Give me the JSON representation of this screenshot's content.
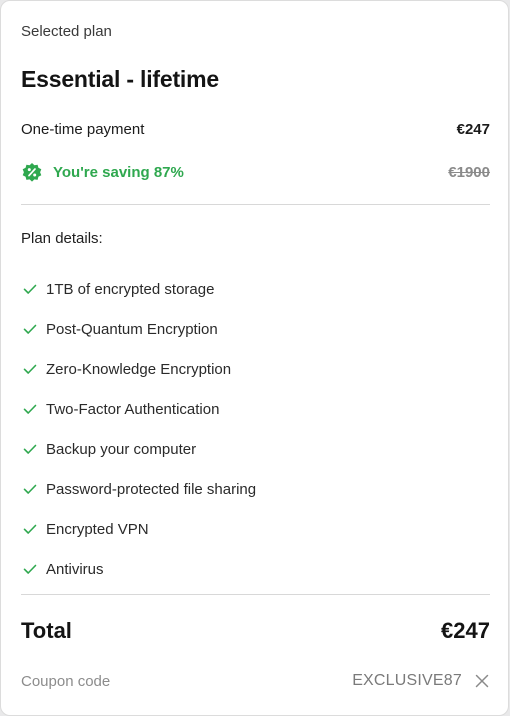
{
  "summary": {
    "selected_label": "Selected plan",
    "plan_name": "Essential - lifetime",
    "payment_label": "One-time payment",
    "payment_value": "€247",
    "saving_text": "You're saving 87%",
    "original_price": "€1900",
    "details_label": "Plan details:",
    "features": [
      "1TB of encrypted storage",
      "Post-Quantum Encryption",
      "Zero-Knowledge Encryption",
      "Two-Factor Authentication",
      "Backup your computer",
      "Password-protected file sharing",
      "Encrypted VPN",
      "Antivirus"
    ],
    "total_label": "Total",
    "total_value": "€247",
    "coupon_label": "Coupon code",
    "coupon_value": "EXCLUSIVE87"
  },
  "icons": {
    "discount": "percent-badge-icon",
    "check": "check-icon",
    "remove": "close-icon"
  },
  "colors": {
    "accent_green": "#2fa84f",
    "muted": "#8c8c8c"
  }
}
